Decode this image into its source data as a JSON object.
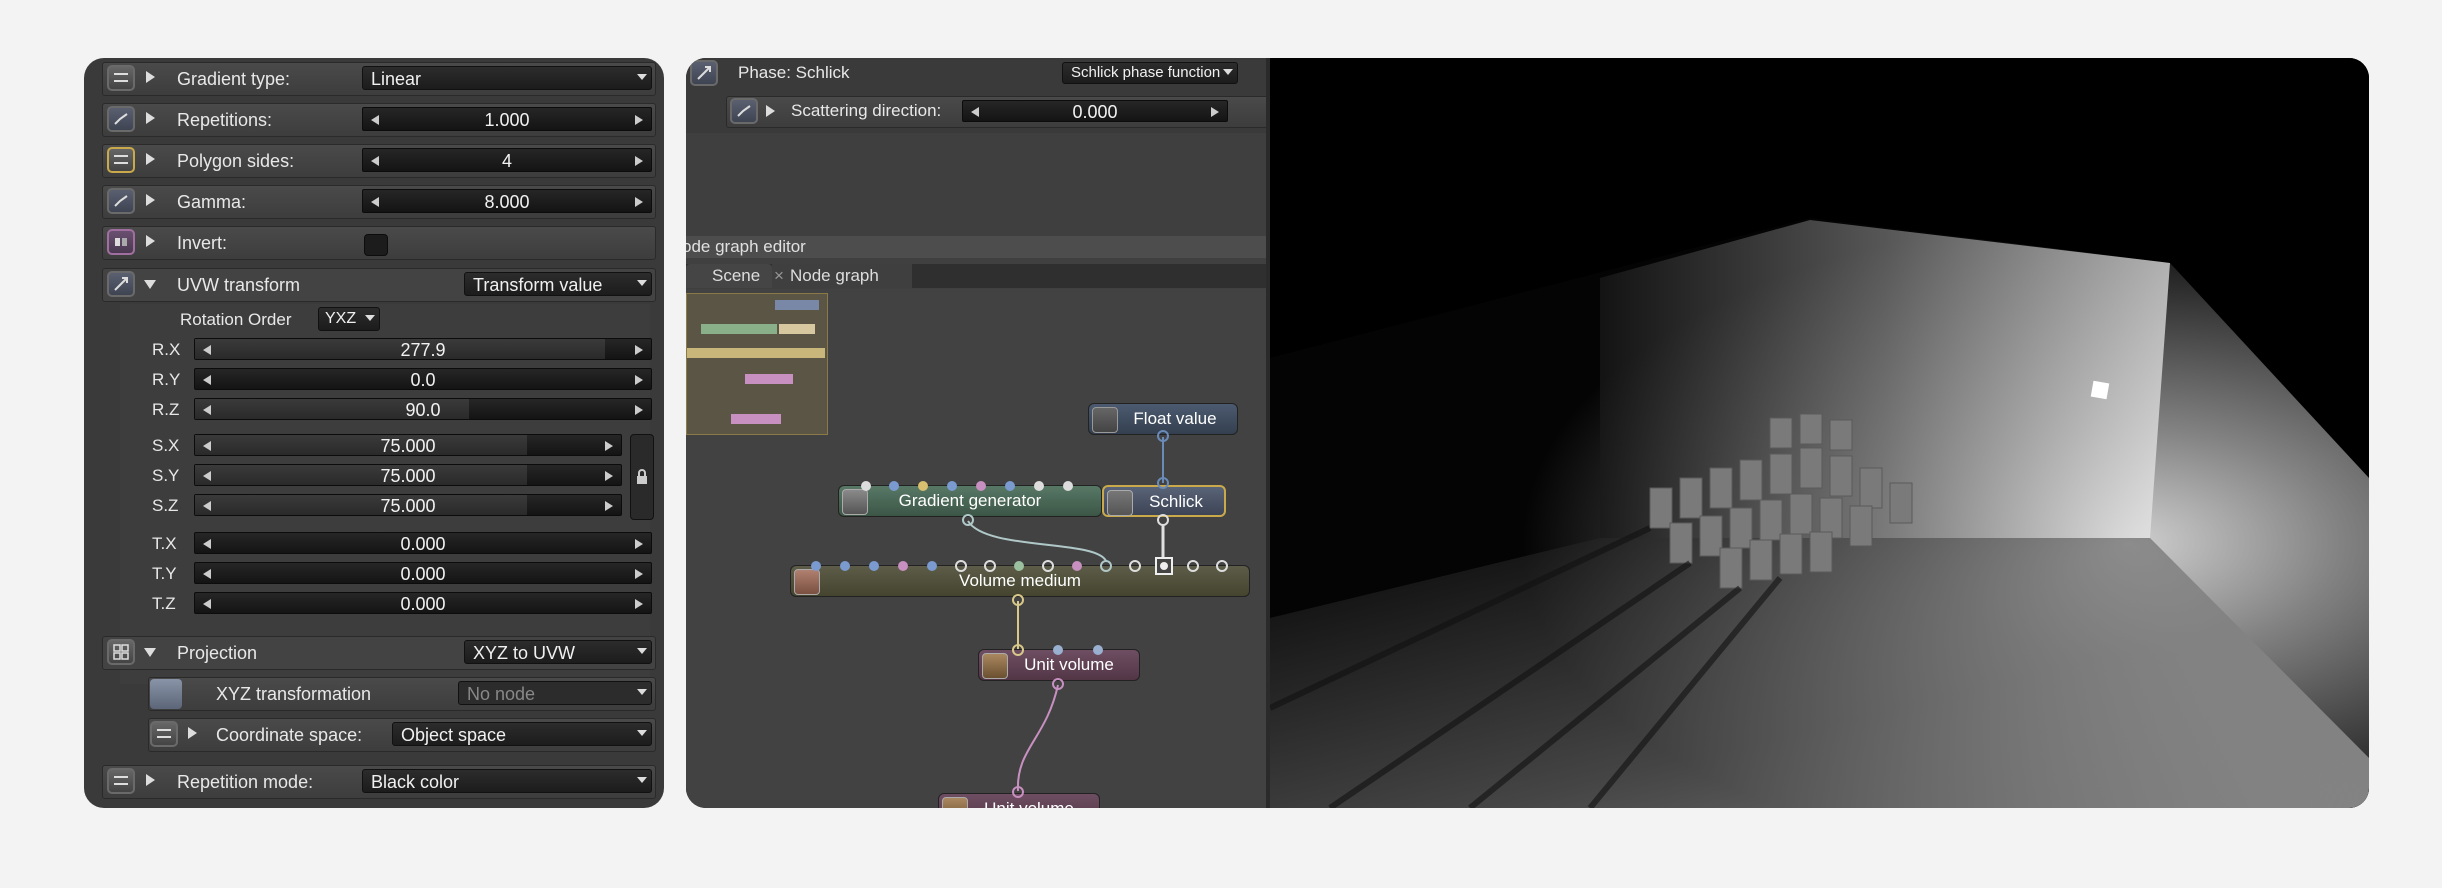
{
  "left_panel": {
    "gradient_type": {
      "label": "Gradient type:",
      "value": "Linear"
    },
    "repetitions": {
      "label": "Repetitions:",
      "value": "1.000"
    },
    "polygon_sides": {
      "label": "Polygon sides:",
      "value": "4"
    },
    "gamma": {
      "label": "Gamma:",
      "value": "8.000"
    },
    "invert": {
      "label": "Invert:"
    },
    "uvw_transform": {
      "label": "UVW transform",
      "value": "Transform value"
    },
    "rotation_order": {
      "label": "Rotation Order",
      "value": "YXZ"
    },
    "rotation": [
      {
        "axis": "R.X",
        "value": "277.9",
        "level": 0.9
      },
      {
        "axis": "R.Y",
        "value": "0.0",
        "level": 0.0
      },
      {
        "axis": "R.Z",
        "value": "90.0",
        "level": 0.6
      }
    ],
    "scale": [
      {
        "axis": "S.X",
        "value": "75.000",
        "level": 0.78
      },
      {
        "axis": "S.Y",
        "value": "75.000",
        "level": 0.78
      },
      {
        "axis": "S.Z",
        "value": "75.000",
        "level": 0.78
      }
    ],
    "translation": [
      {
        "axis": "T.X",
        "value": "0.000"
      },
      {
        "axis": "T.Y",
        "value": "0.000"
      },
      {
        "axis": "T.Z",
        "value": "0.000"
      }
    ],
    "projection": {
      "label": "Projection",
      "value": "XYZ to UVW"
    },
    "xyz_transformation": {
      "label": "XYZ transformation",
      "value": "No node"
    },
    "coordinate_space": {
      "label": "Coordinate space:",
      "value": "Object space"
    },
    "repetition_mode": {
      "label": "Repetition mode:",
      "value": "Black color"
    }
  },
  "node_editor": {
    "phase": {
      "label": "Phase: Schlick",
      "value": "Schlick phase function"
    },
    "scattering": {
      "label": "Scattering direction:",
      "value": "0.000"
    },
    "title": "ode graph editor",
    "tabs": [
      "Scene",
      "Node graph"
    ],
    "nodes": {
      "float_value": "Float value",
      "schlick": "Schlick",
      "gradient_generator": "Gradient generator",
      "volume_medium": "Volume medium",
      "unit_volume_1": "Unit volume",
      "unit_volume_2": "Unit volume"
    }
  },
  "colors": {
    "accent_yellow": "#c9a94a",
    "node_green": "#4c6a55",
    "node_olive": "#5c5c44",
    "node_purple": "#6a4a5c",
    "node_blue": "#3c4a5e"
  }
}
